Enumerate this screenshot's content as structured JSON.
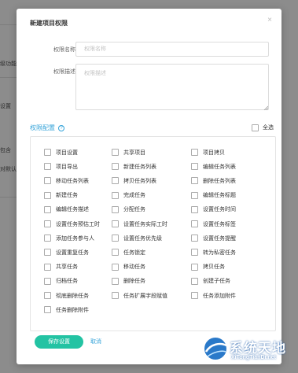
{
  "background": {
    "fragments": [
      "级功能",
      "设置",
      "包含",
      "对默认"
    ]
  },
  "dialog": {
    "title": "新建项目权限",
    "close": "×",
    "name_label": "权限名称",
    "name_placeholder": "权限名称",
    "name_value": "",
    "desc_label": "权限描述",
    "desc_placeholder": "权限描述",
    "desc_value": "",
    "section_title": "权限配置",
    "help": "?",
    "select_all": "全选",
    "permissions": [
      [
        "项目设置",
        "共享项目",
        "项目拷贝"
      ],
      [
        "项目导出",
        "新建任务列表",
        "编辑任务列表"
      ],
      [
        "移动任务列表",
        "拷贝任务列表",
        "删除任务列表"
      ],
      [
        "新建任务",
        "完成任务",
        "编辑任务标题"
      ],
      [
        "编辑任务描述",
        "分配任务",
        "设置任务时间"
      ],
      [
        "设置任务预估工时",
        "设置任务实际工时",
        "设置任务标签"
      ],
      [
        "添加任务参与人",
        "设置任务优先级",
        "设置任务提醒"
      ],
      [
        "设置重复任务",
        "任务锁定",
        "转为私密任务"
      ],
      [
        "共享任务",
        "移动任务",
        "拷贝任务"
      ],
      [
        "归档任务",
        "删除任务",
        "创建子任务"
      ],
      [
        "彻底删除任务",
        "任务扩展字段赋值",
        "任务添加附件"
      ],
      [
        "任务删除附件"
      ]
    ],
    "save_label": "保存设置",
    "cancel_label": "取消"
  },
  "watermark": {
    "title": "系统天地",
    "subtitle": "XiTongTianDi.net"
  }
}
